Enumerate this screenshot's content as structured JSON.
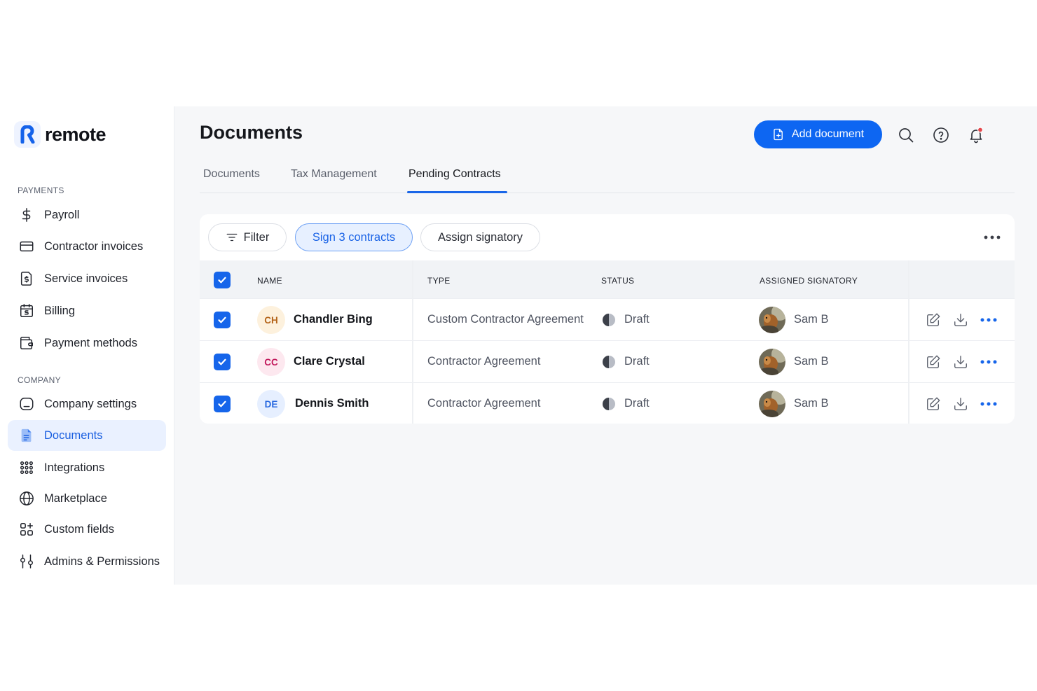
{
  "app": {
    "logo_text": "remote",
    "logo_icon": "remote-r-logo"
  },
  "sidebar": {
    "sections": [
      {
        "label": "PAYMENTS",
        "items": [
          {
            "label": "Payroll",
            "icon": "dollar-icon"
          },
          {
            "label": "Contractor invoices",
            "icon": "credit-card-icon"
          },
          {
            "label": "Service invoices",
            "icon": "invoice-icon"
          },
          {
            "label": "Billing",
            "icon": "billing-icon"
          },
          {
            "label": "Payment methods",
            "icon": "wallet-icon"
          }
        ]
      },
      {
        "label": "COMPANY",
        "items": [
          {
            "label": "Company settings",
            "icon": "company-icon"
          },
          {
            "label": "Documents",
            "icon": "document-icon",
            "active": true
          },
          {
            "label": "Integrations",
            "icon": "grid-dots-icon"
          },
          {
            "label": "Marketplace",
            "icon": "globe-icon"
          },
          {
            "label": "Custom fields",
            "icon": "custom-fields-icon"
          },
          {
            "label": "Admins & Permissions",
            "icon": "permissions-icon"
          }
        ]
      }
    ]
  },
  "header": {
    "title": "Documents",
    "add_button": "Add document",
    "icons": [
      "search-icon",
      "help-icon",
      "notification-bell-icon"
    ]
  },
  "tabs": [
    {
      "label": "Documents",
      "active": false
    },
    {
      "label": "Tax Management",
      "active": false
    },
    {
      "label": "Pending Contracts",
      "active": true
    }
  ],
  "toolbar": {
    "filter_label": "Filter",
    "sign_label": "Sign 3 contracts",
    "assign_label": "Assign signatory"
  },
  "table": {
    "columns": [
      "NAME",
      "TYPE",
      "STATUS",
      "ASSIGNED SIGNATORY"
    ],
    "rows": [
      {
        "initials": "CH",
        "name": "Chandler Bing",
        "type": "Custom Contractor Agreement",
        "status": "Draft",
        "signatory": "Sam B",
        "checked": true
      },
      {
        "initials": "CC",
        "name": "Clare Crystal",
        "type": "Contractor Agreement",
        "status": "Draft",
        "signatory": "Sam B",
        "checked": true
      },
      {
        "initials": "DE",
        "name": "Dennis Smith",
        "type": "Contractor Agreement",
        "status": "Draft",
        "signatory": "Sam B",
        "checked": true
      }
    ]
  },
  "colors": {
    "accent": "#0d66f2",
    "active_nav_bg": "#eaf1ff",
    "notification_dot": "#e5484d",
    "avatar_ch_bg": "#fdf1dd",
    "avatar_ch_fg": "#b4641a",
    "avatar_cc_bg": "#fde8ef",
    "avatar_cc_fg": "#c2185b",
    "avatar_de_bg": "#e6efff",
    "avatar_de_fg": "#2a6ae0"
  }
}
